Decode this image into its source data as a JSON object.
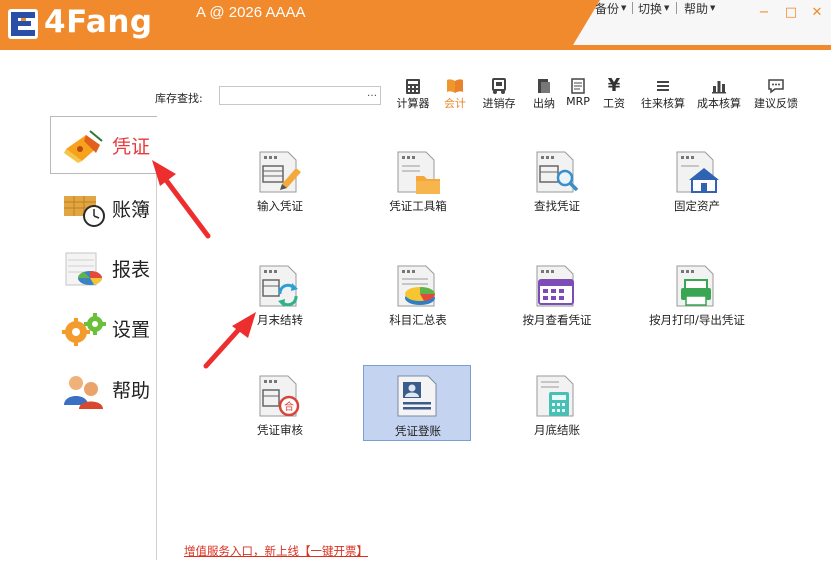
{
  "app": {
    "logo_text": "4Fang",
    "window_title": "A @ 2026 AAAA",
    "brand_color": "#f08a2c"
  },
  "top_menu": {
    "backup": "备份",
    "switch": "切换",
    "help": "帮助"
  },
  "window_controls": {
    "minimize": "−",
    "maximize": "□",
    "close": "✕"
  },
  "search": {
    "label": "库存查找:",
    "value": "",
    "ellipsis": "…"
  },
  "toolbar": [
    {
      "label": "计算器",
      "icon": "calculator-icon"
    },
    {
      "label": "会计",
      "icon": "book-icon",
      "active": true
    },
    {
      "label": "进销存",
      "icon": "cart-icon"
    },
    {
      "label": "出纳",
      "icon": "wallet-icon"
    },
    {
      "label": "MRP",
      "icon": "document-icon"
    },
    {
      "label": "工资",
      "icon": "yen-icon"
    },
    {
      "label": "往来核算",
      "icon": "list-icon"
    },
    {
      "label": "成本核算",
      "icon": "bar-chart-icon"
    },
    {
      "label": "建议反馈",
      "icon": "chat-icon"
    }
  ],
  "nav": [
    {
      "label": "凭证",
      "icon": "voucher-icon",
      "selected": true
    },
    {
      "label": "账簿",
      "icon": "ledger-icon"
    },
    {
      "label": "报表",
      "icon": "report-icon"
    },
    {
      "label": "设置",
      "icon": "settings-icon"
    },
    {
      "label": "帮助",
      "icon": "help-icon"
    }
  ],
  "grid": [
    {
      "label": "输入凭证",
      "icon": "input-voucher-icon"
    },
    {
      "label": "凭证工具箱",
      "icon": "voucher-toolbox-icon"
    },
    {
      "label": "查找凭证",
      "icon": "search-voucher-icon"
    },
    {
      "label": "固定资产",
      "icon": "fixed-assets-icon"
    },
    {
      "label": "月末结转",
      "icon": "month-end-transfer-icon"
    },
    {
      "label": "科目汇总表",
      "icon": "account-summary-icon"
    },
    {
      "label": "按月查看凭证",
      "icon": "monthly-view-icon"
    },
    {
      "label": "按月打印/导出凭证",
      "icon": "monthly-print-icon"
    },
    {
      "label": "凭证审核",
      "icon": "voucher-audit-icon"
    },
    {
      "label": "凭证登账",
      "icon": "voucher-posting-icon",
      "highlighted": true
    },
    {
      "label": "月底结账",
      "icon": "month-end-close-icon"
    }
  ],
  "footer": {
    "link": "增值服务入口，新上线【一键开票】"
  },
  "colors": {
    "accent": "#f08a2c",
    "selected_nav_text": "#e6393b",
    "highlight_bg": "#c4d3ef",
    "annotation_arrow": "#ee2e2e",
    "footer_link": "#d9301f"
  }
}
